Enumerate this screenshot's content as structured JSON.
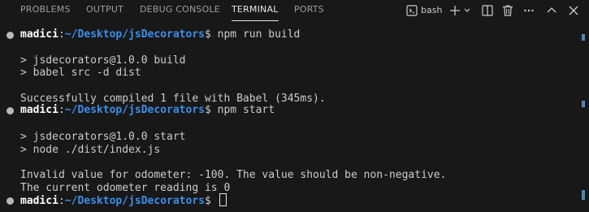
{
  "tabs": [
    {
      "label": "PROBLEMS"
    },
    {
      "label": "OUTPUT"
    },
    {
      "label": "DEBUG CONSOLE"
    },
    {
      "label": "TERMINAL",
      "active": true
    },
    {
      "label": "PORTS"
    }
  ],
  "toolbar": {
    "shell_icon": "terminal-icon",
    "shell_label": "bash",
    "icons": [
      "plus-icon",
      "chevron-down-icon",
      "split-icon",
      "trash-icon",
      "ellipsis-icon",
      "chevron-up-icon",
      "close-icon"
    ]
  },
  "terminal": {
    "prompt_user": "madici",
    "prompt_sep": ":",
    "prompt_path": "~/Desktop/jsDecorators",
    "prompt_symbol": "$",
    "cmd1": " npm run build",
    "out1": "> jsdecorators@1.0.0 build",
    "out2": "> babel src -d dist",
    "out3": "Successfully compiled 1 file with Babel (345ms).",
    "cmd2": " npm start",
    "out4": "> jsdecorators@1.0.0 start",
    "out5": "> node ./dist/index.js",
    "out6": "Invalid value for odometer: -100. The value should be non-negative.",
    "out7": "The current odometer reading is 0",
    "cmd3": " "
  },
  "colors": {
    "background": "#181818",
    "prompt_path": "#3b8eea",
    "scroll_marker": "#4a8bb5"
  }
}
